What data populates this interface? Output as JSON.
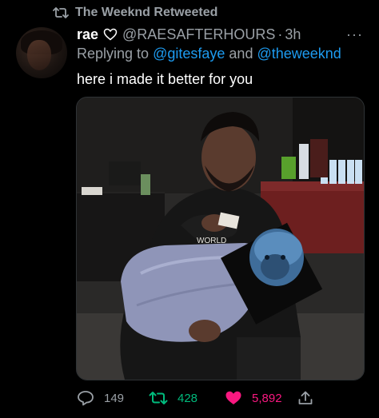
{
  "retweet_banner": {
    "label": "The Weeknd Retweeted"
  },
  "author": {
    "display_name": "rae",
    "handle": "@RAESAFTERHOURS",
    "separator": "·",
    "time": "3h"
  },
  "more_label": "···",
  "reply_context": {
    "prefix": "Replying to",
    "mention_1": "@gitesfaye",
    "conjunction": "and",
    "mention_2": "@theweeknd"
  },
  "tweet_text": "here i made it better for you",
  "media": {
    "sweater_text": "WORLD"
  },
  "actions": {
    "reply_count": "149",
    "retweet_count": "428",
    "like_count": "5,892"
  },
  "colors": {
    "background": "#000000",
    "text_primary": "#ffffff",
    "text_secondary": "#9aa0a6",
    "link": "#1d9bf0",
    "retweet_green": "#00ba7c",
    "like_pink": "#f91880"
  }
}
